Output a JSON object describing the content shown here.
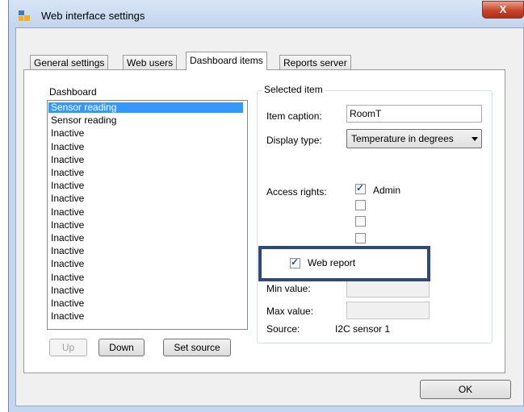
{
  "window": {
    "title": "Web interface settings",
    "close_glyph": "X"
  },
  "tabs": [
    {
      "label": "General settings"
    },
    {
      "label": "Web users"
    },
    {
      "label": "Dashboard items"
    },
    {
      "label": "Reports server"
    }
  ],
  "dashboard": {
    "label": "Dashboard",
    "items": [
      "Sensor reading",
      "Sensor reading",
      "Inactive",
      "Inactive",
      "Inactive",
      "Inactive",
      "Inactive",
      "Inactive",
      "Inactive",
      "Inactive",
      "Inactive",
      "Inactive",
      "Inactive",
      "Inactive",
      "Inactive",
      "Inactive",
      "Inactive"
    ],
    "selected_index": 0,
    "up_label": "Up",
    "down_label": "Down",
    "set_source_label": "Set source"
  },
  "selected_item": {
    "group_title": "Selected item",
    "caption_label": "Item caption:",
    "caption_value": "RoomT",
    "display_type_label": "Display type:",
    "display_type_value": "Temperature in degrees",
    "access_rights_label": "Access rights:",
    "access_rights": [
      {
        "label": "Admin",
        "checked": true
      },
      {
        "label": "",
        "checked": false
      },
      {
        "label": "",
        "checked": false
      },
      {
        "label": "",
        "checked": false
      }
    ],
    "web_report_label": "Web report",
    "web_report_checked": true,
    "min_value_label": "Min value:",
    "min_value": "",
    "max_value_label": "Max value:",
    "max_value": "",
    "source_label": "Source:",
    "source_value": "I2C sensor 1"
  },
  "footer": {
    "ok_label": "OK"
  },
  "colors": {
    "selection": "#3399ff",
    "highlight_border": "#2e4a7a",
    "close_button": "#c7452b"
  }
}
